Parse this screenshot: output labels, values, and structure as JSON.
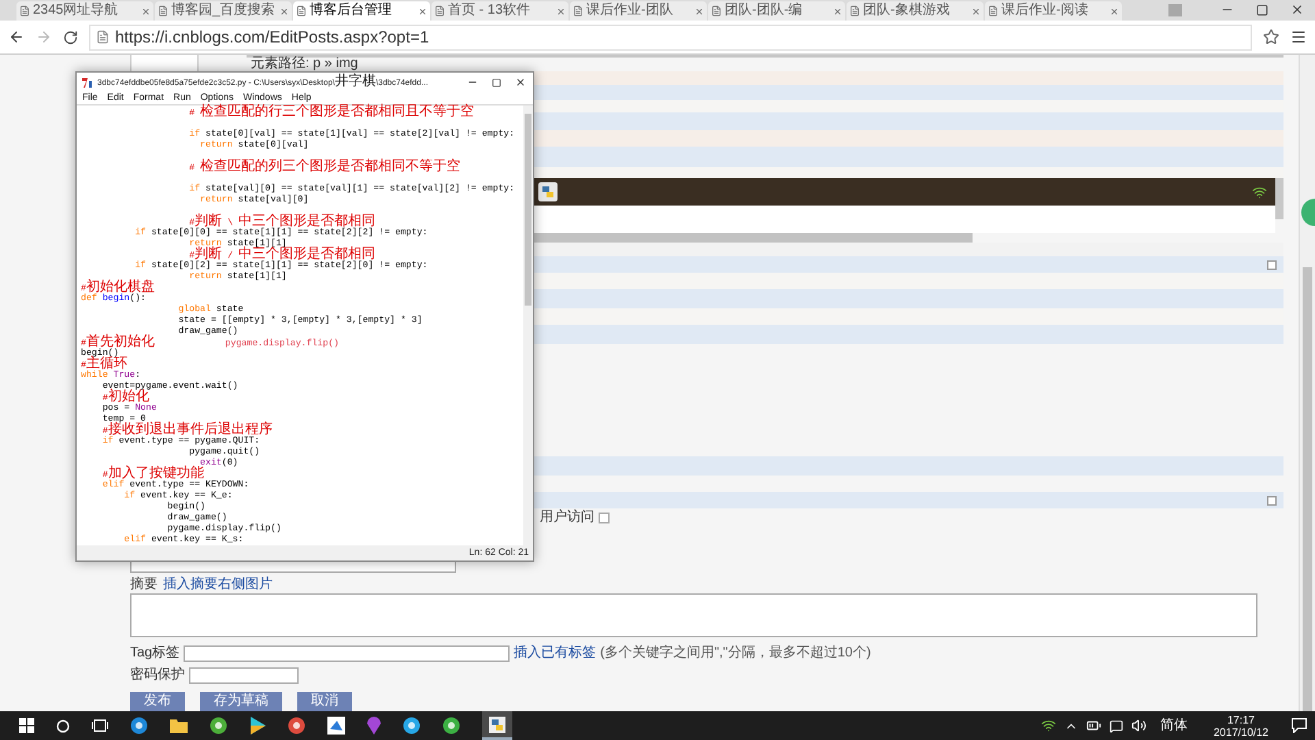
{
  "browser": {
    "tabs": [
      {
        "title": "2345网址导航",
        "selected": false
      },
      {
        "title": "博客园_百度搜索",
        "selected": false
      },
      {
        "title": "博客后台管理",
        "selected": true
      },
      {
        "title": "首页 - 13软件",
        "selected": false
      },
      {
        "title": "课后作业-团队",
        "selected": false
      },
      {
        "title": "团队-团队-编",
        "selected": false
      },
      {
        "title": "团队-象棋游戏",
        "selected": false
      },
      {
        "title": "课后作业-阅读",
        "selected": false
      }
    ],
    "address": "https://i.cnblogs.com/EditPosts.aspx?opt=1"
  },
  "editor": {
    "element_path": "元素路径: p » img",
    "allow_access": {
      "label": "用户访问",
      "checked": false
    }
  },
  "idle_window": {
    "title": "3dbc74efddbe05fe8d5a75efde2c3c52.py - C:\\Users\\syx\\Desktop\\井字棋\\3dbc74efdd...",
    "menu": [
      "File",
      "Edit",
      "Format",
      "Run",
      "Options",
      "Windows",
      "Help"
    ],
    "code_lines": [
      {
        "kind": "code",
        "segments": [
          {
            "kind": "comment",
            "text": "                    # 检查匹配的行三个图形是否都相同且不等于空"
          }
        ]
      },
      {
        "kind": "blank"
      },
      {
        "kind": "code",
        "segments": [
          {
            "kind": "keyword",
            "text": "                    if"
          },
          {
            "kind": "code",
            "text": " state[0][val] == state[1][val] == state[2][val] != empty:"
          }
        ]
      },
      {
        "kind": "code",
        "segments": [
          {
            "kind": "keyword",
            "text": "                      return"
          },
          {
            "kind": "code",
            "text": " state[0][val]"
          }
        ]
      },
      {
        "kind": "blank"
      },
      {
        "kind": "code",
        "segments": [
          {
            "kind": "comment",
            "text": "                    # 检查匹配的列三个图形是否都相同不等于空"
          }
        ]
      },
      {
        "kind": "blank"
      },
      {
        "kind": "code",
        "segments": [
          {
            "kind": "keyword",
            "text": "                    if"
          },
          {
            "kind": "code",
            "text": " state[val][0] == state[val][1] == state[val][2] != empty:"
          }
        ]
      },
      {
        "kind": "code",
        "segments": [
          {
            "kind": "keyword",
            "text": "                      return"
          },
          {
            "kind": "code",
            "text": " state[val][0]"
          }
        ]
      },
      {
        "kind": "blank"
      },
      {
        "kind": "code",
        "segments": [
          {
            "kind": "comment",
            "text": "                    #判断 \\ 中三个图形是否都相同"
          }
        ]
      },
      {
        "kind": "code",
        "segments": [
          {
            "kind": "keyword",
            "text": "          if"
          },
          {
            "kind": "code",
            "text": " state[0][0] == state[1][1] == state[2][2] != empty:"
          }
        ]
      },
      {
        "kind": "code",
        "segments": [
          {
            "kind": "keyword",
            "text": "                    return"
          },
          {
            "kind": "code",
            "text": " state[1][1]"
          }
        ]
      },
      {
        "kind": "code",
        "segments": [
          {
            "kind": "comment",
            "text": "                    #判断 / 中三个图形是否都相同"
          }
        ]
      },
      {
        "kind": "code",
        "segments": [
          {
            "kind": "keyword",
            "text": "          if"
          },
          {
            "kind": "code",
            "text": " state[0][2] == state[1][1] == state[2][0] != empty:"
          }
        ]
      },
      {
        "kind": "code",
        "segments": [
          {
            "kind": "keyword",
            "text": "                    return"
          },
          {
            "kind": "code",
            "text": " state[1][1]"
          }
        ]
      },
      {
        "kind": "code",
        "segments": [
          {
            "kind": "comment",
            "text": "#初始化棋盘"
          }
        ]
      },
      {
        "kind": "code",
        "segments": [
          {
            "kind": "keyword",
            "text": "def"
          },
          {
            "kind": "defname",
            "text": " begin"
          },
          {
            "kind": "code",
            "text": "():"
          }
        ]
      },
      {
        "kind": "code",
        "segments": [
          {
            "kind": "keyword",
            "text": "                  global"
          },
          {
            "kind": "code",
            "text": " state"
          }
        ]
      },
      {
        "kind": "code",
        "segments": [
          {
            "kind": "code",
            "text": "                  state = [[empty] * 3,[empty] * 3,[empty] * 3]"
          }
        ]
      },
      {
        "kind": "code",
        "segments": [
          {
            "kind": "code",
            "text": "                  draw_game()"
          }
        ]
      },
      {
        "kind": "code",
        "segments": [
          {
            "kind": "comment",
            "text": "#首先初始化"
          },
          {
            "kind": "highlight",
            "text": "             pygame.display.flip()"
          }
        ]
      },
      {
        "kind": "code",
        "segments": [
          {
            "kind": "code",
            "text": "begin()"
          }
        ]
      },
      {
        "kind": "code",
        "segments": [
          {
            "kind": "comment",
            "text": "#主循环"
          }
        ]
      },
      {
        "kind": "code",
        "segments": [
          {
            "kind": "keyword",
            "text": "while"
          },
          {
            "kind": "builtin",
            "text": " True"
          },
          {
            "kind": "code",
            "text": ":"
          }
        ]
      },
      {
        "kind": "code",
        "segments": [
          {
            "kind": "code",
            "text": "    event=pygame.event.wait()"
          }
        ]
      },
      {
        "kind": "code",
        "segments": [
          {
            "kind": "comment",
            "text": "    #初始化"
          }
        ]
      },
      {
        "kind": "code",
        "segments": [
          {
            "kind": "code",
            "text": "    pos = "
          },
          {
            "kind": "builtin",
            "text": "None"
          }
        ]
      },
      {
        "kind": "code",
        "segments": [
          {
            "kind": "code",
            "text": "    temp = 0"
          }
        ]
      },
      {
        "kind": "code",
        "segments": [
          {
            "kind": "comment",
            "text": "    #接收到退出事件后退出程序"
          }
        ]
      },
      {
        "kind": "code",
        "segments": [
          {
            "kind": "keyword",
            "text": "    if"
          },
          {
            "kind": "code",
            "text": " event.type == pygame.QUIT:"
          }
        ]
      },
      {
        "kind": "code",
        "segments": [
          {
            "kind": "code",
            "text": "                    pygame.quit()"
          }
        ]
      },
      {
        "kind": "code",
        "segments": [
          {
            "kind": "builtin",
            "text": "                      exit"
          },
          {
            "kind": "code",
            "text": "(0)"
          }
        ]
      },
      {
        "kind": "code",
        "segments": [
          {
            "kind": "comment",
            "text": "    #加入了按键功能"
          }
        ]
      },
      {
        "kind": "code",
        "segments": [
          {
            "kind": "keyword",
            "text": "    elif"
          },
          {
            "kind": "code",
            "text": " event.type == KEYDOWN:"
          }
        ]
      },
      {
        "kind": "code",
        "segments": [
          {
            "kind": "keyword",
            "text": "        if"
          },
          {
            "kind": "code",
            "text": " event.key == K_e:"
          }
        ]
      },
      {
        "kind": "code",
        "segments": [
          {
            "kind": "code",
            "text": "                begin()"
          }
        ]
      },
      {
        "kind": "code",
        "segments": [
          {
            "kind": "code",
            "text": "                draw_game()"
          }
        ]
      },
      {
        "kind": "code",
        "segments": [
          {
            "kind": "code",
            "text": "                pygame.display.flip()"
          }
        ]
      },
      {
        "kind": "code",
        "segments": [
          {
            "kind": "keyword",
            "text": "        elif"
          },
          {
            "kind": "code",
            "text": " event.key == K_s:"
          }
        ]
      }
    ],
    "status": "Ln: 62 Col: 21"
  },
  "form": {
    "summary_label": "摘要",
    "summary_link": "插入摘要右侧图片",
    "tag_label": "Tag标签",
    "tag_link": "插入已有标签",
    "tag_hint": "(多个关键字之间用\",\"分隔，最多不超过10个)",
    "password_label": "密码保护",
    "buttons": [
      "发布",
      "存为草稿",
      "取消"
    ]
  },
  "taskbar": {
    "ime": "简体",
    "time": "17:17",
    "date": "2017/10/12"
  }
}
